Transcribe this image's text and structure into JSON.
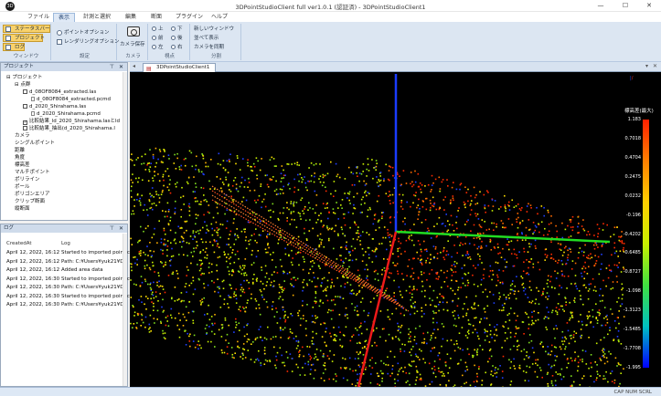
{
  "window": {
    "title": "3DPointStudioClient full ver1.0.1 (認証済) - 3DPointStudioClient1",
    "minimize": "—",
    "maximize": "☐",
    "close": "✕"
  },
  "menubar": [
    "ファイル",
    "表示",
    "計測と選択",
    "編集",
    "断面",
    "プラグイン",
    "ヘルプ"
  ],
  "ribbon": {
    "window_group": {
      "label": "ウィンドウ",
      "status_bar": "ステータスバー",
      "project": "プロジェクト",
      "log": "ログ"
    },
    "settings_group": {
      "label": "設定",
      "point_option": "ポイントオプション",
      "render_option": "レンダリングオプション"
    },
    "camera_group": {
      "label": "カメラ",
      "save": "カメラ保存"
    },
    "viewpoint_group": {
      "label": "視点",
      "items": [
        "上",
        "下",
        "前",
        "後",
        "左",
        "右"
      ]
    },
    "split_group": {
      "label": "分割",
      "new_window": "新しいウィンドウ",
      "tile": "並べて表示",
      "sync": "カメラを同期"
    }
  },
  "project_panel": {
    "title": "プロジェクト",
    "tree": [
      {
        "label": "プロジェクト",
        "indent": 0,
        "kind": "toggle"
      },
      {
        "label": "点群",
        "indent": 1,
        "kind": "toggle"
      },
      {
        "label": "d_08OF8084_extracted.las",
        "indent": 2,
        "kind": "check",
        "checked": false
      },
      {
        "label": "d_08OF8084_extracted.pcmd",
        "indent": 3,
        "kind": "file"
      },
      {
        "label": "d_2020_Shirahama.las",
        "indent": 2,
        "kind": "check",
        "checked": false
      },
      {
        "label": "d_2020_Shirahama.pcmd",
        "indent": 3,
        "kind": "file"
      },
      {
        "label": "比較結果_ld_2020_Shirahama.lasとld",
        "indent": 2,
        "kind": "check",
        "checked": true
      },
      {
        "label": "比較結果_抽出(d_2020_Shirahama.l",
        "indent": 2,
        "kind": "check",
        "checked": false
      },
      {
        "label": "カメラ",
        "indent": 1,
        "kind": "plain"
      },
      {
        "label": "シングルポイント",
        "indent": 1,
        "kind": "plain"
      },
      {
        "label": "距離",
        "indent": 1,
        "kind": "plain"
      },
      {
        "label": "角度",
        "indent": 1,
        "kind": "plain"
      },
      {
        "label": "標高差",
        "indent": 1,
        "kind": "plain"
      },
      {
        "label": "マルチポイント",
        "indent": 1,
        "kind": "plain"
      },
      {
        "label": "ポリライン",
        "indent": 1,
        "kind": "plain"
      },
      {
        "label": "ポール",
        "indent": 1,
        "kind": "plain"
      },
      {
        "label": "ポリゴンエリア",
        "indent": 1,
        "kind": "plain"
      },
      {
        "label": "クリップ断面",
        "indent": 1,
        "kind": "plain"
      },
      {
        "label": "縦断面",
        "indent": 1,
        "kind": "plain"
      }
    ]
  },
  "log_panel": {
    "title": "ログ",
    "col_created": "CreatedAt",
    "col_log": "Log",
    "rows": [
      {
        "created": "April 12, 2022, 16:12",
        "log": "Started to imported point c"
      },
      {
        "created": "April 12, 2022, 16:12",
        "log": "Path: C:¥Users¥yuk21¥De"
      },
      {
        "created": "April 12, 2022, 16:12",
        "log": "Added area data"
      },
      {
        "created": "April 12, 2022, 16:30",
        "log": "Started to imported point c"
      },
      {
        "created": "April 12, 2022, 16:30",
        "log": "Path: C:¥Users¥yuk21¥De"
      },
      {
        "created": "April 12, 2022, 16:30",
        "log": "Started to imported point c"
      },
      {
        "created": "April 12, 2022, 16:30",
        "log": "Path: C:¥Users¥yuk21¥De"
      }
    ]
  },
  "doc_tab": "3DPointStudioClient1",
  "legend": {
    "title": "標高差(最大)",
    "ticks": [
      "1.183",
      "0.7018",
      "0.4704",
      "0.2475",
      "0.0232",
      "-0.196",
      "-0.4202",
      "-0.6485",
      "-0.8727",
      "-1.098",
      "-1.3123",
      "-1.5485",
      "-1.7708",
      "-1.995"
    ],
    "colors": [
      "#ff2000",
      "#ff8000",
      "#ffd000",
      "#c8f000",
      "#40e040",
      "#00c0c0",
      "#0000ff"
    ]
  },
  "status": {
    "right": "CAP  NUM  SCRL"
  }
}
